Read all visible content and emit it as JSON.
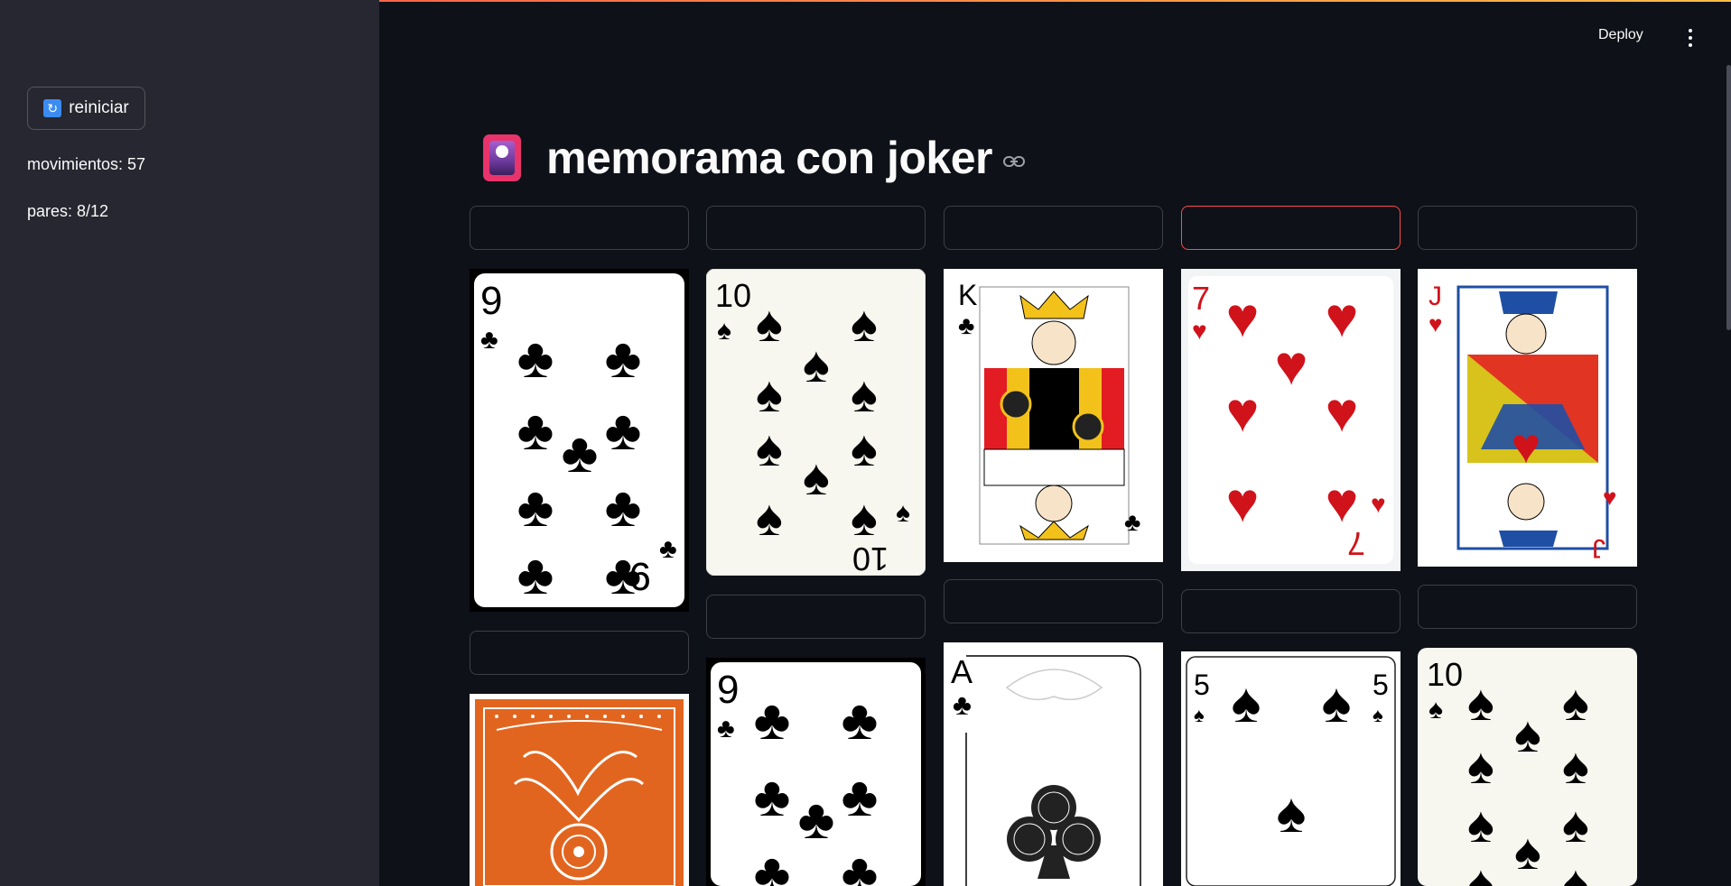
{
  "app": {
    "deploy_label": "Deploy",
    "menu_icon": "kebab-menu-icon",
    "accent": "#ff4b4b"
  },
  "sidebar": {
    "restart_button": {
      "label": "reiniciar",
      "icon": "refresh-icon"
    },
    "moves_text": "movimientos: 57",
    "pairs_text": "pares: 8/12"
  },
  "main": {
    "title": "memorama con joker",
    "title_icon": "playing-card-icon",
    "anchor_icon": "link-icon",
    "cards": [
      {
        "face": "9 of clubs",
        "rank": "9",
        "suit": "clubs",
        "color": "#000000"
      },
      {
        "face": "10 of spades",
        "rank": "10",
        "suit": "spades",
        "color": "#000000"
      },
      {
        "face": "King of clubs",
        "rank": "K",
        "suit": "clubs",
        "color": "#000000"
      },
      {
        "face": "7 of hearts",
        "rank": "7",
        "suit": "hearts",
        "color": "#d0121b"
      },
      {
        "face": "Jack of hearts",
        "rank": "J",
        "suit": "hearts",
        "color": "#d0121b"
      },
      {
        "face": "card back",
        "rank": "",
        "suit": "",
        "color": "#e2651f"
      },
      {
        "face": "9 of clubs",
        "rank": "9",
        "suit": "clubs",
        "color": "#000000"
      },
      {
        "face": "Ace of clubs",
        "rank": "A",
        "suit": "clubs",
        "color": "#000000"
      },
      {
        "face": "5 of spades",
        "rank": "5",
        "suit": "spades",
        "color": "#000000"
      },
      {
        "face": "10 of spades",
        "rank": "10",
        "suit": "spades",
        "color": "#000000"
      }
    ]
  }
}
